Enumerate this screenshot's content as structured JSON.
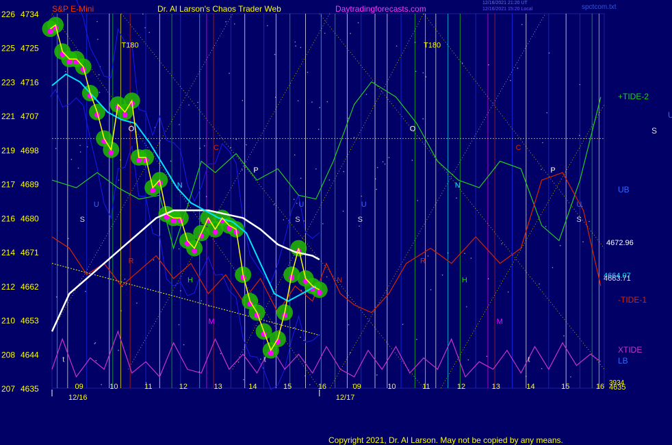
{
  "header": {
    "symbol": "S&P E-Mini",
    "author_title": "Dr. Al Larson's Chaos Trader Web",
    "site": "Daytradingforecasts.com",
    "timestamp_line1": "12/16/2021 21:20 UT",
    "timestamp_line2": "12/16/2021 15:20 Local",
    "filename": "spctcom.txt"
  },
  "copyright": "Copyright 2021, Dr. Al Larson. May not be copied by any means.",
  "colors": {
    "background": "#000066",
    "price": "#ffff00",
    "green_glow": "#22bb00",
    "magenta": "#ff00ff",
    "cyan_avg": "#00e5ff",
    "white_avg": "#ffffff",
    "tide_plus": "#22cc22",
    "tide_minus": "#dd2200",
    "xtide": "#cc33cc",
    "bands": "#1a1aee"
  },
  "chart_data": {
    "type": "line",
    "title": "S&P E-Mini",
    "y_axis_labels": [
      {
        "left": "226",
        "right": "4734"
      },
      {
        "left": "225",
        "right": "4725"
      },
      {
        "left": "223",
        "right": "4716"
      },
      {
        "left": "221",
        "right": "4707"
      },
      {
        "left": "219",
        "right": "4698"
      },
      {
        "left": "217",
        "right": "4689"
      },
      {
        "left": "216",
        "right": "4680"
      },
      {
        "left": "214",
        "right": "4671"
      },
      {
        "left": "212",
        "right": "4662"
      },
      {
        "left": "210",
        "right": "4653"
      },
      {
        "left": "208",
        "right": "4644"
      },
      {
        "left": "207",
        "right": "4635"
      }
    ],
    "ylim": [
      4635,
      4734
    ],
    "xlim": [
      8.3,
      24.2
    ],
    "x_hour_ticks": [
      {
        "x": 9,
        "label": "09"
      },
      {
        "x": 10,
        "label": "10"
      },
      {
        "x": 11,
        "label": "11"
      },
      {
        "x": 12,
        "label": "12"
      },
      {
        "x": 13,
        "label": "13"
      },
      {
        "x": 14,
        "label": "14"
      },
      {
        "x": 15,
        "label": "15"
      },
      {
        "x": 16,
        "label": "16"
      },
      {
        "x": 17,
        "label": "09"
      },
      {
        "x": 18,
        "label": "10"
      },
      {
        "x": 19,
        "label": "11"
      },
      {
        "x": 20,
        "label": "12"
      },
      {
        "x": 21,
        "label": "13"
      },
      {
        "x": 22,
        "label": "14"
      },
      {
        "x": 23,
        "label": "15"
      },
      {
        "x": 24,
        "label": "16"
      }
    ],
    "date_labels": [
      {
        "x": 8.3,
        "label": "12/16"
      },
      {
        "x": 16.0,
        "label": "12/17"
      }
    ],
    "right_values": [
      "4672.96",
      "4664.07",
      "4663.71",
      "4635"
    ],
    "right_value_partial": "3934",
    "series": [
      {
        "name": "price",
        "x": [
          8.25,
          8.4,
          8.6,
          8.8,
          9.0,
          9.2,
          9.4,
          9.6,
          9.8,
          10.0,
          10.2,
          10.4,
          10.6,
          10.8,
          11.0,
          11.2,
          11.4,
          11.6,
          11.8,
          12.0,
          12.2,
          12.4,
          12.6,
          12.8,
          13.0,
          13.2,
          13.4,
          13.6,
          13.8,
          14.0,
          14.2,
          14.4,
          14.6,
          14.8,
          15.0,
          15.2,
          15.4,
          15.6,
          15.8,
          16.0
        ],
        "y": [
          4730,
          4731,
          4724,
          4722,
          4722,
          4720,
          4713,
          4708,
          4701,
          4698,
          4710,
          4708,
          4711,
          4696,
          4696,
          4688,
          4690,
          4681,
          4680,
          4680,
          4674,
          4672,
          4676,
          4680,
          4677,
          4680,
          4678,
          4677,
          4665,
          4658,
          4655,
          4650,
          4645,
          4648,
          4655,
          4665,
          4672,
          4664,
          4662,
          4661
        ]
      },
      {
        "name": "moving-average-fast",
        "x": [
          8.3,
          8.7,
          9.1,
          9.5,
          9.9,
          10.3,
          10.7,
          11.1,
          11.5,
          11.9,
          12.3,
          12.7,
          13.1,
          13.5,
          13.9,
          14.3,
          14.7,
          15.1,
          15.5,
          15.9
        ],
        "y": [
          4715,
          4718,
          4716,
          4712,
          4708,
          4706,
          4705,
          4700,
          4694,
          4688,
          4684,
          4682,
          4680,
          4679,
          4676,
          4668,
          4660,
          4658,
          4660,
          4662
        ]
      },
      {
        "name": "moving-average-slow",
        "x": [
          8.3,
          8.8,
          9.3,
          9.8,
          10.3,
          10.8,
          11.3,
          11.8,
          12.3,
          12.8,
          13.3,
          13.8,
          14.3,
          14.8,
          15.3,
          15.8,
          16.0
        ],
        "y": [
          4650,
          4660,
          4664,
          4668,
          4672,
          4676,
          4680,
          4682,
          4682,
          4682,
          4681,
          4680,
          4677,
          4673,
          4671,
          4670,
          4669
        ]
      },
      {
        "name": "+TIDE-2",
        "x": [
          8.3,
          9.0,
          9.6,
          10.2,
          10.8,
          11.4,
          11.8,
          12.2,
          12.6,
          13.0,
          13.6,
          14.2,
          14.8,
          15.4,
          15.9,
          16.4,
          17.0,
          17.5,
          18.2,
          18.8,
          19.4,
          20.0,
          20.6,
          21.2,
          21.8,
          22.4,
          22.9,
          23.5,
          24.1
        ],
        "y": [
          4690,
          4688,
          4692,
          4688,
          4685,
          4686,
          4672,
          4683,
          4695,
          4692,
          4697,
          4690,
          4693,
          4686,
          4685,
          4695,
          4710,
          4716,
          4712,
          4705,
          4695,
          4690,
          4688,
          4695,
          4693,
          4678,
          4674,
          4690,
          4712
        ]
      },
      {
        "name": "-TIDE-1",
        "x": [
          8.3,
          8.8,
          9.3,
          9.8,
          10.3,
          10.8,
          11.3,
          11.8,
          12.3,
          12.8,
          13.3,
          13.8,
          14.3,
          14.8,
          15.3,
          15.8,
          16.2,
          16.6,
          17.0,
          17.5,
          18.0,
          18.5,
          19.2,
          19.8,
          20.5,
          21.2,
          21.8,
          22.4,
          23.0,
          23.6,
          24.1
        ],
        "y": [
          4675,
          4672,
          4665,
          4668,
          4662,
          4666,
          4670,
          4664,
          4668,
          4660,
          4665,
          4658,
          4664,
          4655,
          4662,
          4658,
          4668,
          4660,
          4657,
          4655,
          4660,
          4668,
          4672,
          4668,
          4675,
          4668,
          4672,
          4690,
          4692,
          4682,
          4662
        ]
      },
      {
        "name": "XTIDE",
        "x": [
          8.3,
          8.6,
          9.0,
          9.4,
          9.8,
          10.2,
          10.6,
          11.0,
          11.4,
          11.8,
          12.2,
          12.6,
          13.0,
          13.4,
          13.8,
          14.2,
          14.6,
          15.0,
          15.4,
          15.8,
          16.2,
          16.6,
          17.0,
          17.4,
          17.8,
          18.2,
          18.6,
          19.0,
          19.4,
          19.8,
          20.2,
          20.6,
          21.0,
          21.4,
          21.8,
          22.2,
          22.6,
          23.0,
          23.4,
          23.8,
          24.1
        ],
        "y": [
          4640,
          4648,
          4638,
          4643,
          4640,
          4650,
          4639,
          4642,
          4638,
          4647,
          4640,
          4639,
          4648,
          4640,
          4644,
          4639,
          4646,
          4640,
          4644,
          4639,
          4646,
          4640,
          4638,
          4645,
          4640,
          4646,
          4639,
          4643,
          4640,
          4648,
          4638,
          4642,
          4640,
          4645,
          4639,
          4646,
          4640,
          4647,
          4641,
          4644,
          4642
        ]
      }
    ],
    "annotations": [
      {
        "text": "T180",
        "x": 10.3,
        "y": 4725,
        "color": "#ffff00"
      },
      {
        "text": "T180",
        "x": 19.0,
        "y": 4725,
        "color": "#ffff00"
      },
      {
        "text": "O",
        "x": 10.5,
        "y": 4703,
        "color": "#ffffff"
      },
      {
        "text": "O",
        "x": 18.6,
        "y": 4703,
        "color": "#ffffff"
      },
      {
        "text": "C",
        "x": 12.95,
        "y": 4698,
        "color": "#dd2200"
      },
      {
        "text": "C",
        "x": 21.65,
        "y": 4698,
        "color": "#dd2200"
      },
      {
        "text": "P",
        "x": 14.1,
        "y": 4692,
        "color": "#ffffff"
      },
      {
        "text": "P",
        "x": 22.65,
        "y": 4692,
        "color": "#ffffff"
      },
      {
        "text": "N",
        "x": 11.9,
        "y": 4688,
        "color": "#00e5ff"
      },
      {
        "text": "N",
        "x": 19.9,
        "y": 4688,
        "color": "#00e5ff"
      },
      {
        "text": "S",
        "x": 9.1,
        "y": 4679,
        "color": "#dddddd"
      },
      {
        "text": "S",
        "x": 15.3,
        "y": 4679,
        "color": "#dddddd"
      },
      {
        "text": "S",
        "x": 17.1,
        "y": 4679,
        "color": "#dddddd"
      },
      {
        "text": "S",
        "x": 23.4,
        "y": 4679,
        "color": "#dddddd"
      },
      {
        "text": "U",
        "x": 9.5,
        "y": 4683,
        "color": "#3366ff"
      },
      {
        "text": "U",
        "x": 15.4,
        "y": 4683,
        "color": "#3366ff"
      },
      {
        "text": "U",
        "x": 17.2,
        "y": 4683,
        "color": "#3366ff"
      },
      {
        "text": "U",
        "x": 23.4,
        "y": 4683,
        "color": "#3366ff"
      },
      {
        "text": "R",
        "x": 10.5,
        "y": 4668,
        "color": "#dd2200"
      },
      {
        "text": "R",
        "x": 18.9,
        "y": 4668,
        "color": "#dd2200"
      },
      {
        "text": "N",
        "x": 16.5,
        "y": 4663,
        "color": "#dd2200"
      },
      {
        "text": "H",
        "x": 12.2,
        "y": 4663,
        "color": "#22cc22"
      },
      {
        "text": "H",
        "x": 20.1,
        "y": 4663,
        "color": "#22cc22"
      },
      {
        "text": "M",
        "x": 12.8,
        "y": 4652,
        "color": "#ff00ff"
      },
      {
        "text": "M",
        "x": 21.1,
        "y": 4652,
        "color": "#ff00ff"
      },
      {
        "text": "t",
        "x": 8.6,
        "y": 4642,
        "color": "#dddddd"
      },
      {
        "text": "t",
        "x": 14.4,
        "y": 4642,
        "color": "#dddddd"
      },
      {
        "text": "t",
        "x": 22.0,
        "y": 4642,
        "color": "#dddddd"
      }
    ],
    "right_legend": [
      {
        "text": "+TIDE-2",
        "color": "#22cc22"
      },
      {
        "text": "UB",
        "color": "#3366ff"
      },
      {
        "text": "-TIDE-1",
        "color": "#dd2200"
      },
      {
        "text": "XTIDE",
        "color": "#cc33cc"
      },
      {
        "text": "LB",
        "color": "#3366ff"
      }
    ],
    "far_right_letters": [
      {
        "text": "U",
        "color": "#3366ff"
      },
      {
        "text": "S",
        "color": "#dddddd"
      }
    ],
    "grid": false
  }
}
